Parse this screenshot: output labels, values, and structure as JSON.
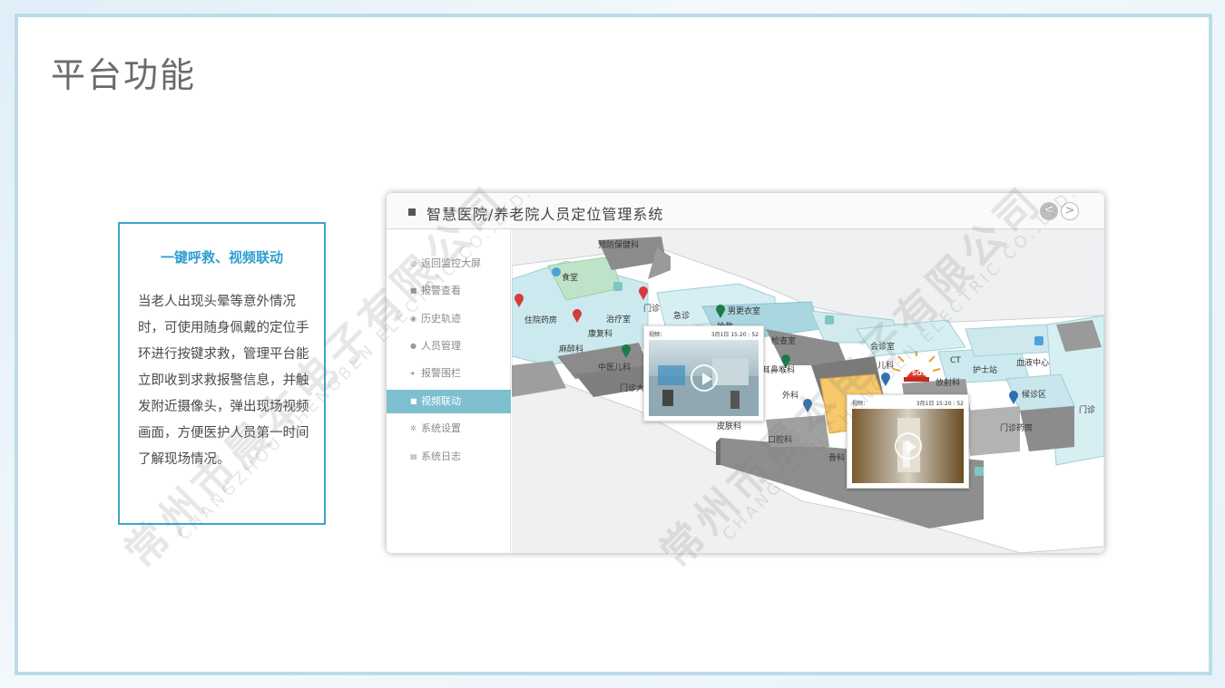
{
  "page": {
    "title": "平台功能"
  },
  "feature": {
    "title": "一键呼救、视频联动",
    "description": "当老人出现头晕等意外情况时，可使用随身佩戴的定位手环进行按键求救，管理平台能立即收到求救报警信息，并触发附近摄像头，弹出现场视频画面，方便医护人员第一时间了解现场情况。"
  },
  "watermark": {
    "company": "常州市晨本电子有限公司",
    "company_en": "CHANGZHOU CHENGBEN ELECTRIC CO.,LTD."
  },
  "app": {
    "title": "智慧医院/养老院人员定位管理系统",
    "nav_prev": "<",
    "nav_next": ">",
    "menu": [
      {
        "label": "返回监控大屏",
        "icon": "monitor-icon",
        "active": false
      },
      {
        "label": "报警查看",
        "icon": "alarm-icon",
        "active": false
      },
      {
        "label": "历史轨迹",
        "icon": "history-icon",
        "active": false
      },
      {
        "label": "人员管理",
        "icon": "person-icon",
        "active": false
      },
      {
        "label": "报警围栏",
        "icon": "fence-icon",
        "active": false
      },
      {
        "label": "视频联动",
        "icon": "video-icon",
        "active": true
      },
      {
        "label": "系统设置",
        "icon": "settings-icon",
        "active": false
      },
      {
        "label": "系统日志",
        "icon": "log-icon",
        "active": false
      }
    ],
    "map": {
      "labels": [
        "预防保健科",
        "食堂",
        "住院药房",
        "治疗室",
        "门诊",
        "急诊",
        "男更衣室",
        "抢救",
        "康复科",
        "麻醉科",
        "中医儿科",
        "门诊大厅",
        "检查室",
        "会诊室",
        "儿科",
        "放射科",
        "CT",
        "护士站",
        "血液中心",
        "候诊区",
        "门诊药房",
        "门诊",
        "口腔科",
        "骨科",
        "皮肤科",
        "耳鼻喉科",
        "外科"
      ],
      "sos_label": "SOS",
      "videos": [
        {
          "label": "视频：",
          "time": "3月1日 15:20 : 52"
        },
        {
          "label": "视频：",
          "time": "3月1日 15:20 : 52"
        }
      ]
    }
  }
}
